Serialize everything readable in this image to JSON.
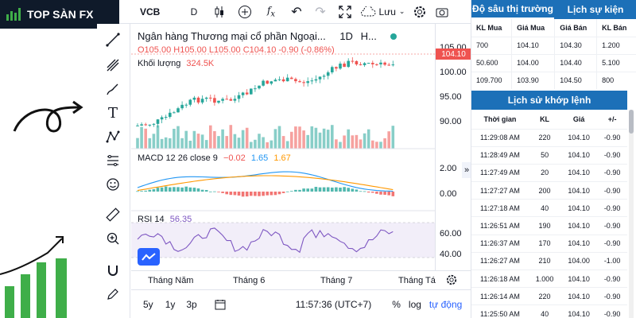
{
  "brand": {
    "name": "TOP SÀN FX"
  },
  "topbar": {
    "symbol": "VCB",
    "interval": "D",
    "save_label": "Lưu"
  },
  "legend": {
    "title": "Ngân hàng Thương mại cổ phần Ngoại...",
    "interval": "1D",
    "exchange": "H...",
    "ohlc": "O105.00 H105.00 L105.00 C104.10 -0.90 (-0.86%)",
    "volume_label": "Khối lượng",
    "volume_value": "324.5K",
    "macd_label": "MACD 12 26 close 9",
    "macd_hist": "−0.02",
    "macd_line": "1.65",
    "macd_signal": "1.67",
    "rsi_label": "RSI 14",
    "rsi_value": "56.35"
  },
  "price_axis": {
    "current_price": "104.10",
    "labels": [
      "105.00",
      "100.00",
      "95.00",
      "90.00"
    ],
    "macd_labels": [
      "2.00",
      "0.00"
    ],
    "rsi_labels": [
      "60.00",
      "40.00"
    ]
  },
  "time_axis": [
    "Tháng Năm",
    "Tháng 6",
    "Tháng 7",
    "Tháng Tá"
  ],
  "bottombar": {
    "ranges": [
      "5y",
      "1y",
      "3p"
    ],
    "clock": "11:57:36 (UTC+7)",
    "percent": "%",
    "log": "log",
    "auto": "tự động"
  },
  "right_panel": {
    "tab_depth": "Độ sâu thị trường",
    "tab_events": "Lịch sự kiện",
    "depth_headers": [
      "KL Mua",
      "Giá Mua",
      "Giá Bán",
      "KL Bán"
    ],
    "depth_rows": [
      [
        "700",
        "104.10",
        "104.30",
        "1.200"
      ],
      [
        "50.600",
        "104.00",
        "104.40",
        "5.100"
      ],
      [
        "109.700",
        "103.90",
        "104.50",
        "800"
      ]
    ],
    "history_title": "Lịch sử khớp lệnh",
    "history_headers": [
      "Thời gian",
      "KL",
      "Giá",
      "+/-"
    ],
    "history_rows": [
      [
        "11:29:08 AM",
        "220",
        "104.10",
        "-0.90"
      ],
      [
        "11:28:49 AM",
        "50",
        "104.10",
        "-0.90"
      ],
      [
        "11:27:49 AM",
        "20",
        "104.10",
        "-0.90"
      ],
      [
        "11:27:27 AM",
        "200",
        "104.10",
        "-0.90"
      ],
      [
        "11:27:18 AM",
        "40",
        "104.10",
        "-0.90"
      ],
      [
        "11:26:51 AM",
        "190",
        "104.10",
        "-0.90"
      ],
      [
        "11:26:37 AM",
        "170",
        "104.10",
        "-0.90"
      ],
      [
        "11:26:27 AM",
        "210",
        "104.00",
        "-1.00"
      ],
      [
        "11:26:18 AM",
        "1.000",
        "104.10",
        "-0.90"
      ],
      [
        "11:26:14 AM",
        "220",
        "104.10",
        "-0.90"
      ],
      [
        "11:25:50 AM",
        "40",
        "104.10",
        "-0.90"
      ]
    ]
  },
  "colors": {
    "up": "#26a69a",
    "down": "#ef5350",
    "accent": "#1c70b8",
    "macd_line": "#2196f3",
    "signal_line": "#ff9800",
    "rsi_line": "#7e57c2"
  }
}
